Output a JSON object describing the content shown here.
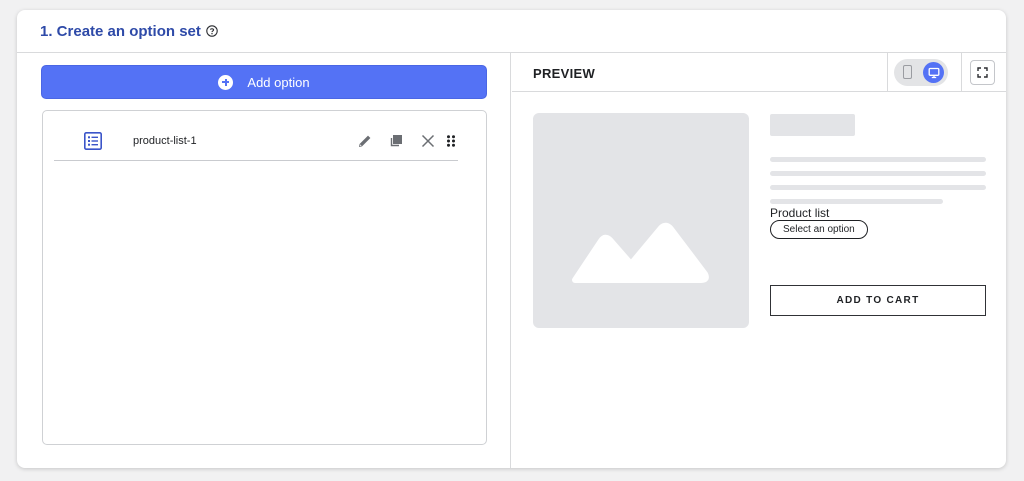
{
  "header": {
    "title": "1. Create an option set",
    "help_icon": "help-circle-icon"
  },
  "left": {
    "add_button_label": "Add option",
    "add_icon": "plus-circle-icon",
    "items": [
      {
        "label": "product-list-1",
        "icon": "list-icon",
        "actions": [
          "edit-icon",
          "duplicate-icon",
          "close-icon",
          "drag-handle-icon"
        ]
      }
    ]
  },
  "preview": {
    "label": "PREVIEW",
    "device_toggle": {
      "options": [
        "mobile",
        "desktop"
      ],
      "selected": "desktop"
    },
    "fullscreen_icon": "expand-icon",
    "product": {
      "image_icon": "image-placeholder-icon",
      "option_label": "Product list",
      "select_label": "Select an option",
      "cart_button": "ADD TO CART"
    }
  },
  "colors": {
    "accent": "#5472f5",
    "title": "#2e4aa8",
    "placeholder": "#e3e4e7"
  }
}
